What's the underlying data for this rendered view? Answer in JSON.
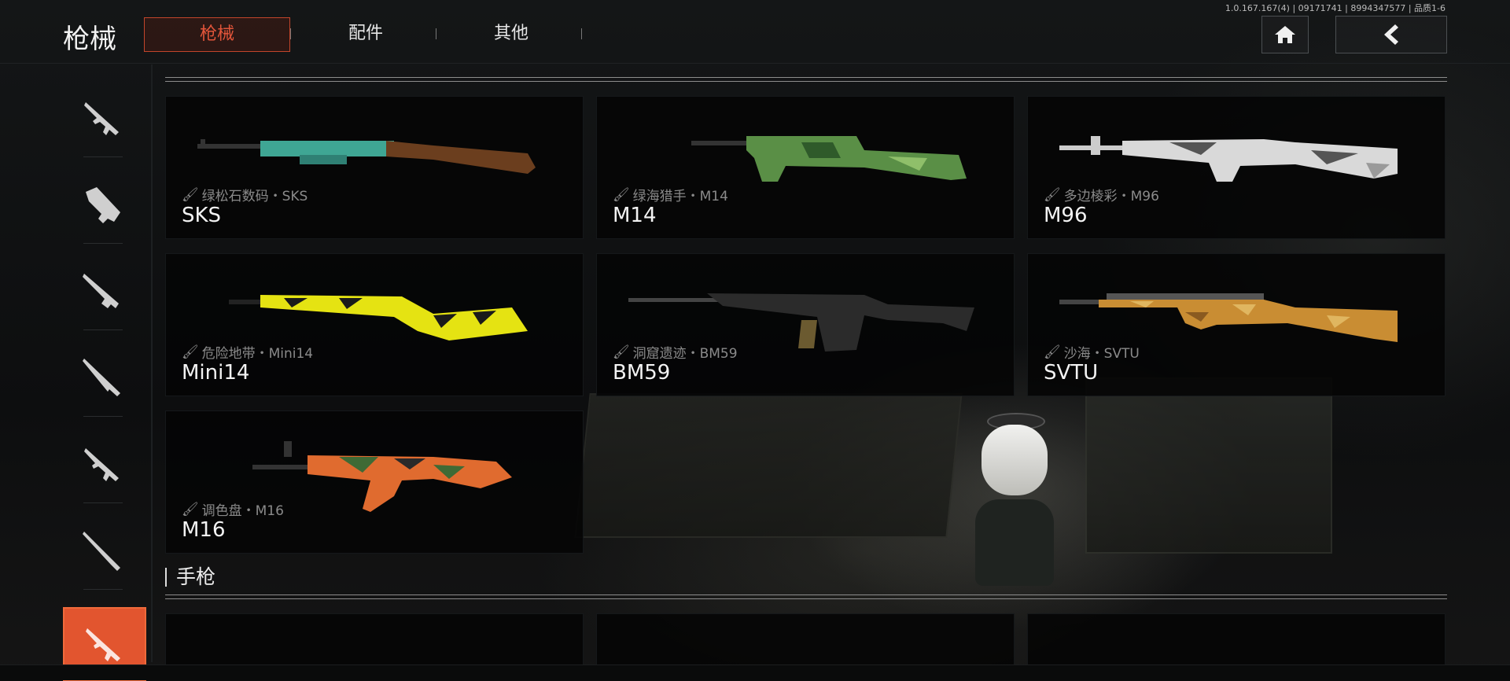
{
  "header": {
    "title": "枪械",
    "tabs": [
      {
        "label": "枪械",
        "active": true
      },
      {
        "label": "配件",
        "active": false
      },
      {
        "label": "其他",
        "active": false
      }
    ],
    "version": "1.0.167.167(4) | 09171741 | 8994347577 | 品质1-6"
  },
  "sidebar": {
    "items": [
      {
        "icon": "assault-rifle-icon"
      },
      {
        "icon": "smg-icon"
      },
      {
        "icon": "lmg-icon"
      },
      {
        "icon": "sniper-rifle-icon"
      },
      {
        "icon": "rifle-icon"
      },
      {
        "icon": "marksman-rifle-icon"
      },
      {
        "icon": "shotgun-icon",
        "active": true
      }
    ],
    "active_color": "#e2552f"
  },
  "weapons": [
    {
      "skin": "绿松石数码・SKS",
      "name": "SKS",
      "colors": [
        "#2f8074",
        "#3fa694",
        "#6b3e1e"
      ]
    },
    {
      "skin": "绿海猎手・M14",
      "name": "M14",
      "colors": [
        "#2f5a2a",
        "#5a8f46",
        "#8fbf6a"
      ]
    },
    {
      "skin": "多边棱彩・M96",
      "name": "M96",
      "colors": [
        "#d9d9d9",
        "#555555",
        "#9a9a9a"
      ]
    },
    {
      "skin": "危险地带・Mini14",
      "name": "Mini14",
      "colors": [
        "#e5e312",
        "#1a1a1a",
        "#b3b020"
      ]
    },
    {
      "skin": "洞窟遗迹・BM59",
      "name": "BM59",
      "colors": [
        "#2b2b2b",
        "#3b3626",
        "#6b5a30"
      ]
    },
    {
      "skin": "沙海・SVTU",
      "name": "SVTU",
      "colors": [
        "#c98d33",
        "#e0b660",
        "#8a5a20"
      ]
    },
    {
      "skin": "调色盘・M16",
      "name": "M16",
      "colors": [
        "#e06b2f",
        "#2a2a2a",
        "#3f6a35"
      ]
    }
  ],
  "section": {
    "title": "手枪"
  }
}
